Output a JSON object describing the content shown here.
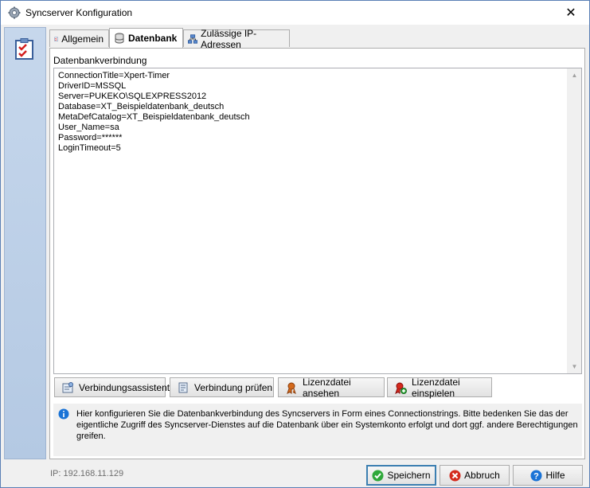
{
  "window": {
    "title": "Syncserver Konfiguration",
    "close_label": "✕"
  },
  "tabs": [
    {
      "label": "Allgemein",
      "icon": "checklist-icon"
    },
    {
      "label": "Datenbank",
      "icon": "database-icon"
    },
    {
      "label": "Zulässige IP-Adressen",
      "icon": "network-icon"
    }
  ],
  "database": {
    "section_label": "Datenbankverbindung",
    "connection_lines": [
      "ConnectionTitle=Xpert-Timer",
      "DriverID=MSSQL",
      "Server=PUKEKO\\SQLEXPRESS2012",
      "Database=XT_Beispieldatenbank_deutsch",
      "MetaDefCatalog=XT_Beispieldatenbank_deutsch",
      "User_Name=sa",
      "Password=******",
      "LoginTimeout=5"
    ],
    "buttons": [
      {
        "label": "Verbindungsassistent",
        "icon": "wizard-icon"
      },
      {
        "label": "Verbindung prüfen",
        "icon": "check-connection-icon"
      },
      {
        "label": "Lizenzdatei ansehen",
        "icon": "license-view-icon"
      },
      {
        "label": "Lizenzdatei einspielen",
        "icon": "license-import-icon"
      }
    ],
    "info_text": "Hier konfigurieren Sie die Datenbankverbindung des Syncservers in Form eines Connectionstrings. Bitte bedenken Sie das der eigentliche Zugriff des Syncserver-Dienstes auf die Datenbank über ein Systemkonto erfolgt und dort ggf. andere Berechtigungen greifen."
  },
  "footer": {
    "ip": "IP: 192.168.11.129",
    "save_label": "Speichern",
    "cancel_label": "Abbruch",
    "help_label": "Hilfe"
  },
  "colors": {
    "accent": "#3c7fb1",
    "sidebar": "#c6d7ec",
    "info": "#1a73d6"
  }
}
